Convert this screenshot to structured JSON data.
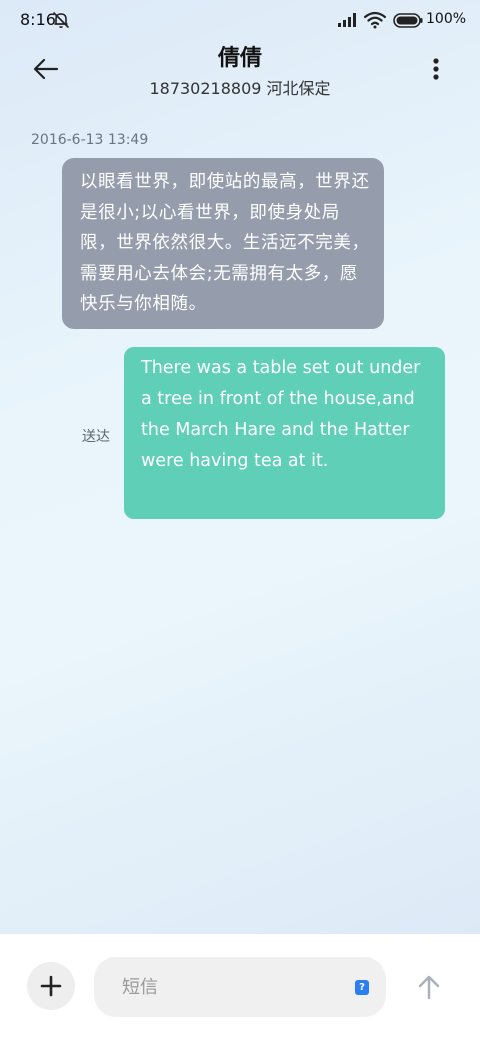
{
  "status_bar": {
    "time": "8:16",
    "battery": "100%",
    "icons": [
      "bell-off-icon",
      "signal-icon",
      "wifi-icon",
      "battery-icon"
    ]
  },
  "header": {
    "back_icon": "arrow-left-icon",
    "contact_name": "倩倩",
    "contact_sub": "18730218809 河北保定",
    "more_icon": "more-vertical-icon"
  },
  "messages": {
    "timestamp": "2016-6-13 13:49",
    "incoming": {
      "text": "以眼看世界，即使站的最高，世界还是很小;以心看世界，即使身处局限，世界依然很大。生活远不完美，需要用心去体会;无需拥有太多，愿快乐与你相随。",
      "color": "#959dad"
    },
    "outgoing": {
      "text": "There was a table set out under a tree in front of the house,and the March Hare and the Hatter were having tea at it.",
      "status": "送达",
      "color": "#5fcfb8"
    }
  },
  "composer": {
    "add_icon": "plus-icon",
    "placeholder": "短信",
    "value": "",
    "sim_badge": "?",
    "send_icon": "arrow-up-icon",
    "accent": "#2a7ef0"
  }
}
